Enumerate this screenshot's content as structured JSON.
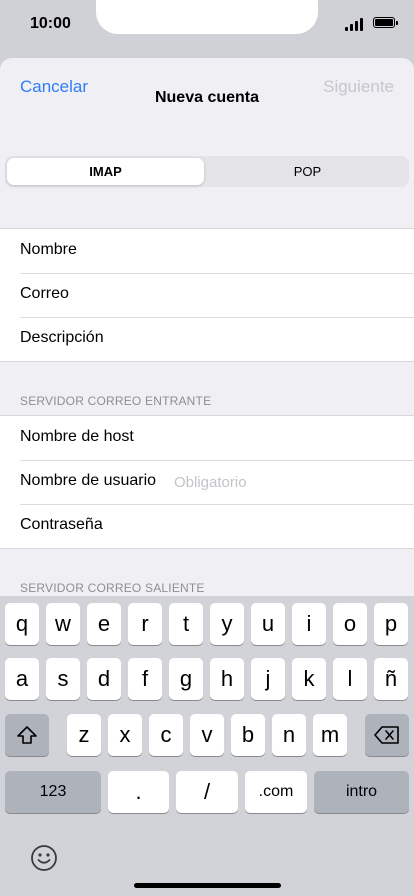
{
  "status": {
    "time": "10:00"
  },
  "nav": {
    "cancel": "Cancelar",
    "title": "Nueva cuenta",
    "next": "Siguiente"
  },
  "segment": {
    "options": [
      "IMAP",
      "POP"
    ],
    "selected": "IMAP"
  },
  "account": {
    "rows": [
      "Nombre",
      "Correo",
      "Descripción"
    ]
  },
  "incoming": {
    "header": "SERVIDOR CORREO ENTRANTE",
    "rows": [
      "Nombre de host",
      "Nombre de usuario",
      "Contraseña"
    ],
    "username_placeholder": "Obligatorio"
  },
  "outgoing": {
    "header": "SERVIDOR CORREO SALIENTE"
  },
  "keyboard": {
    "row1": [
      "q",
      "w",
      "e",
      "r",
      "t",
      "y",
      "u",
      "i",
      "o",
      "p"
    ],
    "row2": [
      "a",
      "s",
      "d",
      "f",
      "g",
      "h",
      "j",
      "k",
      "l",
      "ñ"
    ],
    "row3": [
      "z",
      "x",
      "c",
      "v",
      "b",
      "n",
      "m"
    ],
    "numbers": "123",
    "dot": ".",
    "slash": "/",
    "dotcom": ".com",
    "return": "intro"
  },
  "colors": {
    "accent": "#2f7cf6",
    "disabled": "#c6c6cc",
    "placeholder": "#c4c4c9"
  }
}
